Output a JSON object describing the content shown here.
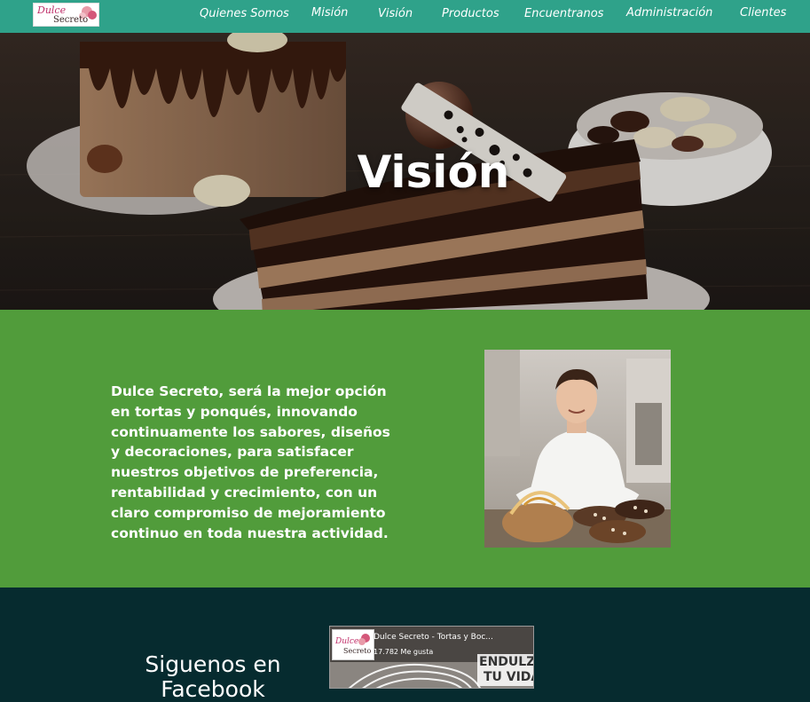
{
  "brand": {
    "line1": "Dulce",
    "line2": "Secreto"
  },
  "nav": {
    "items": [
      {
        "label": "Quienes Somos"
      },
      {
        "label": "Misión"
      },
      {
        "label": "Visión"
      },
      {
        "label": "Productos"
      },
      {
        "label": "Encuentranos"
      },
      {
        "label": "Administración"
      },
      {
        "label": "Clientes"
      }
    ]
  },
  "hero": {
    "title": "Visión"
  },
  "vision": {
    "text": "Dulce Secreto, será la mejor opción en tortas y ponqués, innovando continuamente los sabores, diseños y decoraciones, para satisfacer nuestros objetivos de preferencia, rentabilidad y crecimiento, con un claro compromiso de mejoramiento continuo en toda nuestra actividad."
  },
  "footer": {
    "follow": "Siguenos en Facebook",
    "fb_page_name": "Dulce Secreto - Tortas y Boc...",
    "fb_likes": "17.782 Me gusta",
    "fb_slogan_line1": "ENDULZA",
    "fb_slogan_line2": "TU VIDA"
  },
  "colors": {
    "nav": "#2fa28a",
    "vision_bg": "#519c3b",
    "footer_bg": "#062b2f",
    "brand_pink": "#c0306a"
  }
}
